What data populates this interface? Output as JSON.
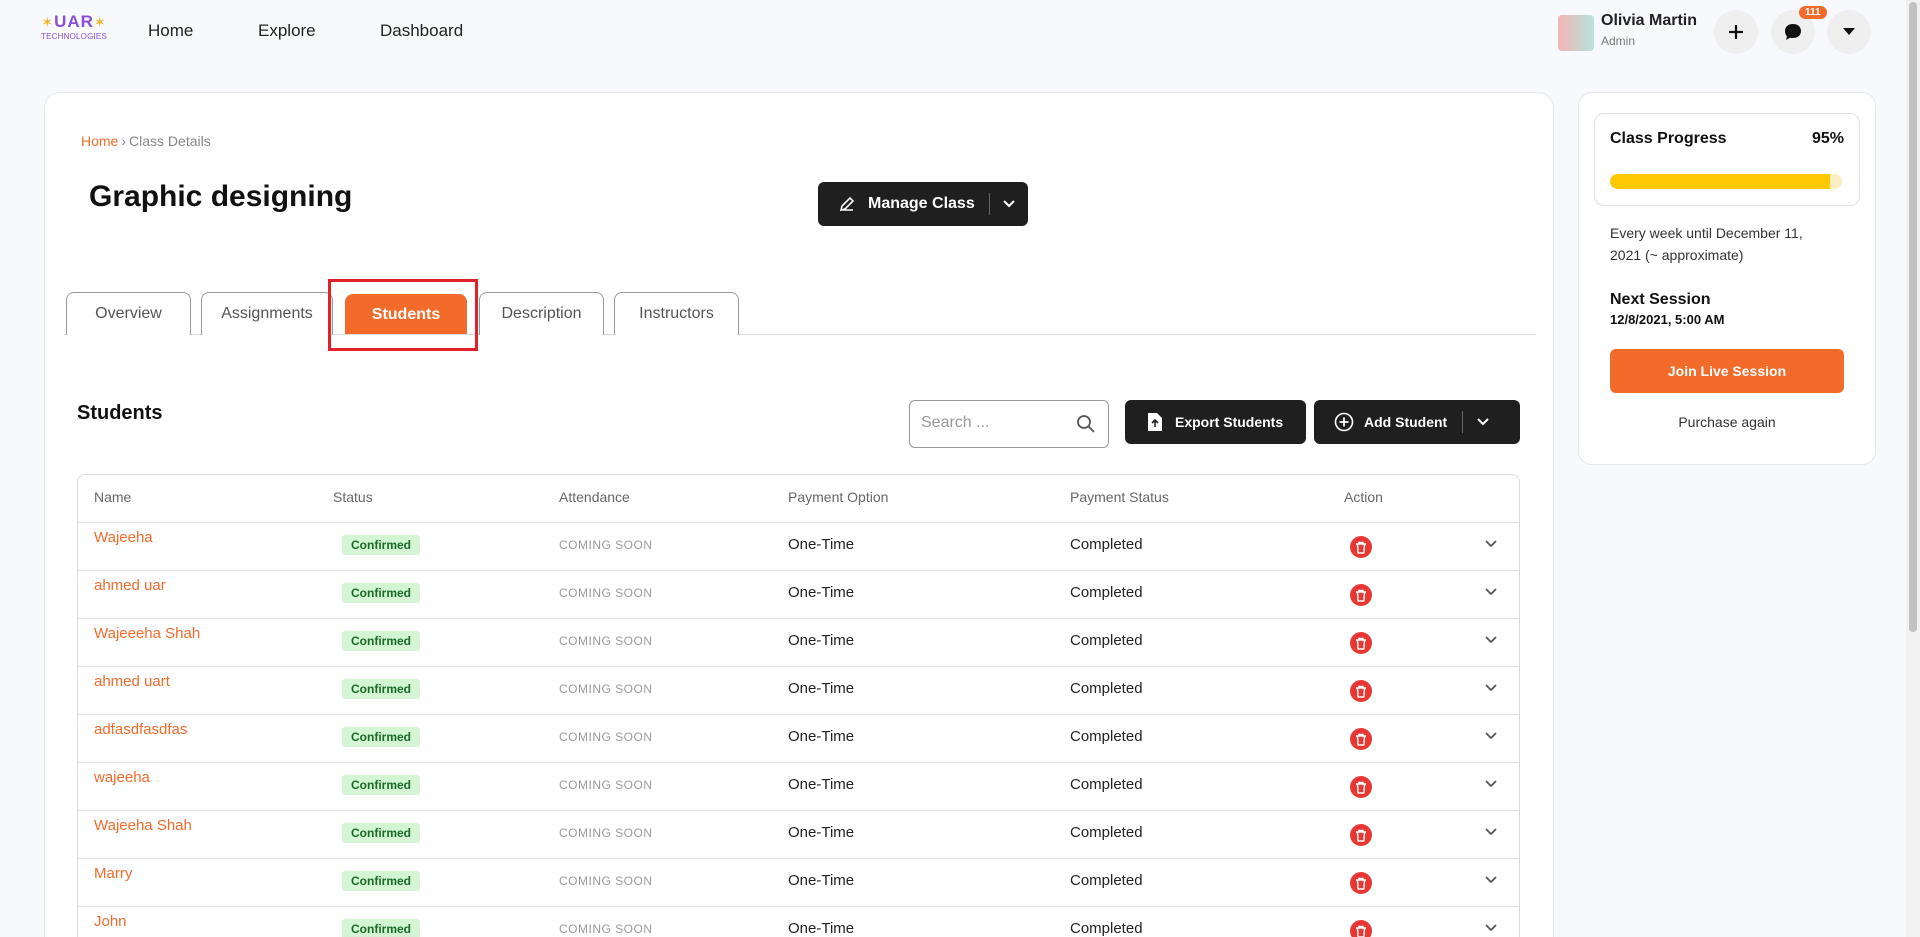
{
  "nav": {
    "logo_top": "UAR",
    "logo_bottom": "TECHNOLOGIES",
    "links": [
      "Home",
      "Explore",
      "Dashboard"
    ],
    "user_name": "Olivia Martin",
    "user_role": "Admin",
    "notification_count": "111"
  },
  "breadcrumb": {
    "home": "Home",
    "separator": "›",
    "current": "Class Details"
  },
  "page": {
    "title": "Graphic designing",
    "manage_label": "Manage Class"
  },
  "tabs": [
    "Overview",
    "Assignments",
    "Students",
    "Description",
    "Instructors"
  ],
  "active_tab": "Students",
  "students": {
    "heading": "Students",
    "search_placeholder": "Search ...",
    "export_label": "Export Students",
    "add_label": "Add Student",
    "columns": [
      "Name",
      "Status",
      "Attendance",
      "Payment Option",
      "Payment Status",
      "Action"
    ],
    "rows": [
      {
        "name": "Wajeeha",
        "status": "Confirmed",
        "attendance": "COMING SOON",
        "payment_option": "One-Time",
        "payment_status": "Completed"
      },
      {
        "name": "ahmed uar",
        "status": "Confirmed",
        "attendance": "COMING SOON",
        "payment_option": "One-Time",
        "payment_status": "Completed"
      },
      {
        "name": "Wajeeeha Shah",
        "status": "Confirmed",
        "attendance": "COMING SOON",
        "payment_option": "One-Time",
        "payment_status": "Completed"
      },
      {
        "name": "ahmed uart",
        "status": "Confirmed",
        "attendance": "COMING SOON",
        "payment_option": "One-Time",
        "payment_status": "Completed"
      },
      {
        "name": "adfasdfasdfas",
        "status": "Confirmed",
        "attendance": "COMING SOON",
        "payment_option": "One-Time",
        "payment_status": "Completed"
      },
      {
        "name": "wajeeha",
        "status": "Confirmed",
        "attendance": "COMING SOON",
        "payment_option": "One-Time",
        "payment_status": "Completed"
      },
      {
        "name": "Wajeeha Shah",
        "status": "Confirmed",
        "attendance": "COMING SOON",
        "payment_option": "One-Time",
        "payment_status": "Completed"
      },
      {
        "name": "Marry",
        "status": "Confirmed",
        "attendance": "COMING SOON",
        "payment_option": "One-Time",
        "payment_status": "Completed"
      },
      {
        "name": "John",
        "status": "Confirmed",
        "attendance": "COMING SOON",
        "payment_option": "One-Time",
        "payment_status": "Completed"
      }
    ]
  },
  "sidebar": {
    "progress_title": "Class Progress",
    "progress_percent": "95%",
    "progress_value": 95,
    "schedule": "Every week until December 11, 2021 (~ approximate)",
    "next_session_label": "Next Session",
    "next_session_value": "12/8/2021, 5:00 AM",
    "join_label": "Join Live Session",
    "purchase_label": "Purchase again"
  },
  "colors": {
    "accent": "#f26b2a",
    "dark": "#1f1f1f",
    "progress": "#ffc800",
    "confirmed_bg": "#d4f5d4",
    "delete": "#e53935",
    "highlight": "#e0202a"
  },
  "icons": {
    "manage": "edit-pencil-icon",
    "search": "search-icon",
    "export": "file-export-icon",
    "add": "plus-circle-icon",
    "delete": "trash-icon",
    "expand": "chevron-down-icon"
  }
}
